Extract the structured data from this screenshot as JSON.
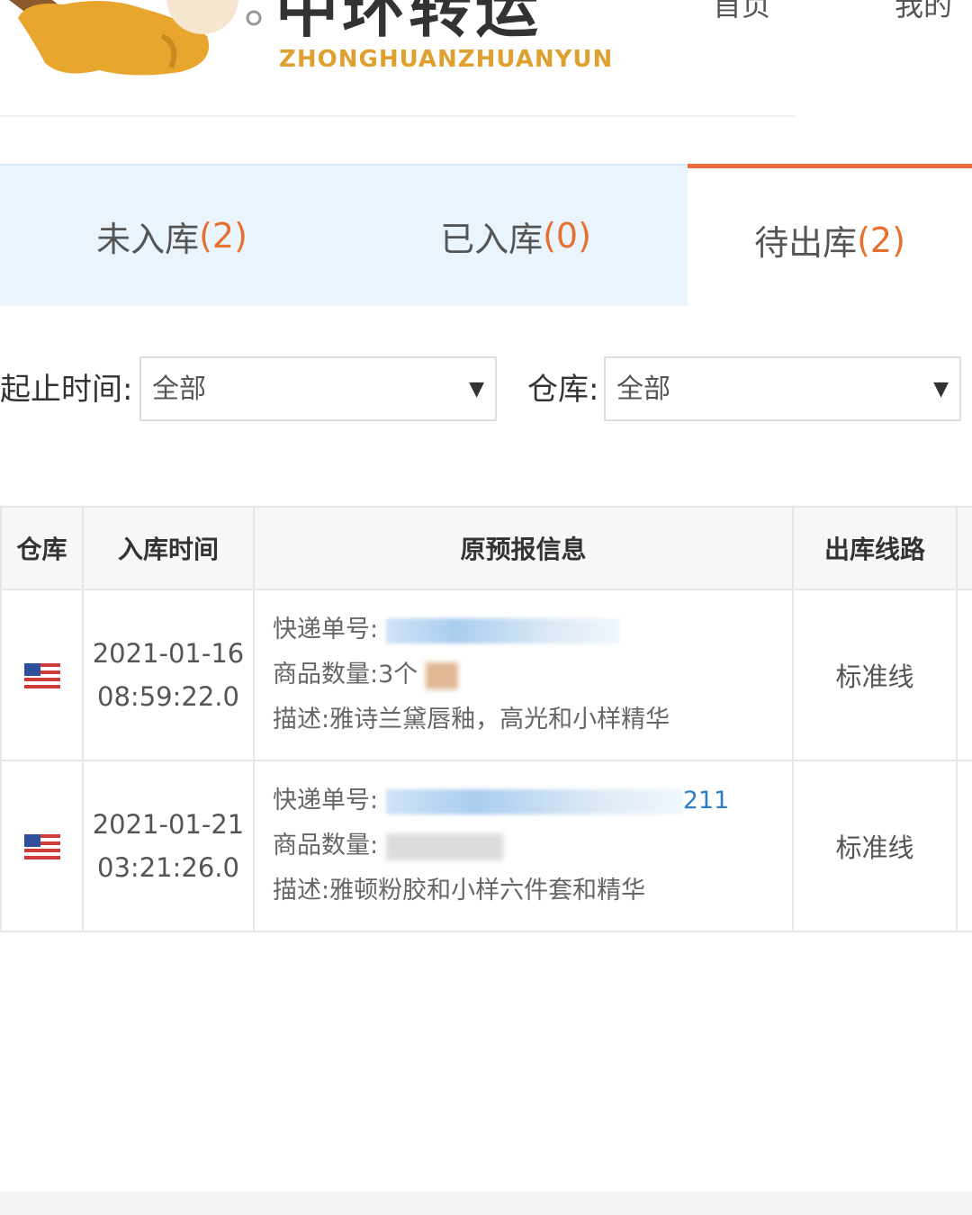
{
  "header": {
    "brand_cn": "中环转运",
    "brand_en": "ZHONGHUANZHUANYUN",
    "nav": [
      "首页",
      "我的"
    ]
  },
  "tabs": [
    {
      "label": "未入库",
      "count": "(2)"
    },
    {
      "label": "已入库",
      "count": "(0)"
    },
    {
      "label": "待出库",
      "count": "(2)"
    }
  ],
  "filters": {
    "time_label": "起止时间:",
    "time_value": "全部",
    "warehouse_label": "仓库:",
    "warehouse_value": "全部",
    "dropdown_arrow": "▼"
  },
  "table": {
    "headers": [
      "仓库",
      "入库时间",
      "原预报信息",
      "出库线路"
    ],
    "rows": [
      {
        "warehouse_icon": "us-flag-icon",
        "date": "2021-01-16",
        "time": "08:59:22.0",
        "tracking_label": "快递单号:",
        "tracking_tail": "",
        "quantity_label": "商品数量:",
        "quantity": "3个",
        "desc_label": "描述:",
        "desc": "雅诗兰黛唇釉，高光和小样精华",
        "route": "标准线"
      },
      {
        "warehouse_icon": "us-flag-icon",
        "date": "2021-01-21",
        "time": "03:21:26.0",
        "tracking_label": "快递单号:",
        "tracking_tail": "211",
        "quantity_label": "商品数量:",
        "quantity": "",
        "desc_label": "描述:",
        "desc": "雅顿粉胶和小样六件套和精华",
        "route": "标准线"
      }
    ]
  },
  "colors": {
    "accent": "#ec6a3f",
    "count": "#e6702e",
    "tab_inactive_bg": "#e9f4fd",
    "link": "#2c7fc4",
    "brand_en": "#e0a030"
  }
}
